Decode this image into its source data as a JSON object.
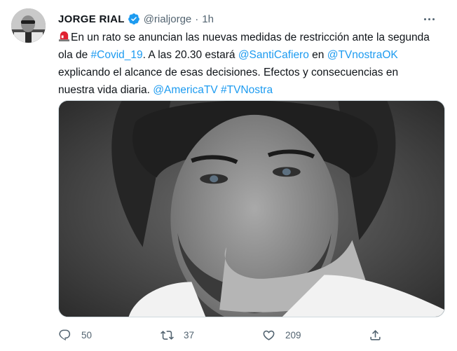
{
  "author": {
    "name": "JORGE RIAL",
    "handle": "@rialjorge",
    "separator": "·",
    "time": "1h",
    "verified": true
  },
  "tweet": {
    "emoji": "🚨",
    "segments": [
      {
        "type": "text",
        "value": "En un rato se anuncian las nuevas medidas de restricción ante la segunda ola de "
      },
      {
        "type": "link",
        "value": "#Covid_19"
      },
      {
        "type": "text",
        "value": ". A las 20.30 estará "
      },
      {
        "type": "link",
        "value": "@SantiCafiero"
      },
      {
        "type": "text",
        "value": " en "
      },
      {
        "type": "link",
        "value": "@TVnostraOK"
      },
      {
        "type": "text",
        "value": " explicando el alcance de esas decisiones. Efectos y consecuencias en nuestra vida diaria. "
      },
      {
        "type": "link",
        "value": "@AmericaTV"
      },
      {
        "type": "text",
        "value": " "
      },
      {
        "type": "link",
        "value": "#TVNostra"
      }
    ]
  },
  "actions": {
    "reply_count": "50",
    "retweet_count": "37",
    "like_count": "209"
  },
  "colors": {
    "link": "#1d9bf0",
    "muted": "#536471",
    "verified": "#1d9bf0"
  },
  "icons": [
    "more-icon",
    "verified-badge-icon",
    "siren-emoji-icon",
    "reply-icon",
    "retweet-icon",
    "like-icon",
    "share-icon"
  ]
}
